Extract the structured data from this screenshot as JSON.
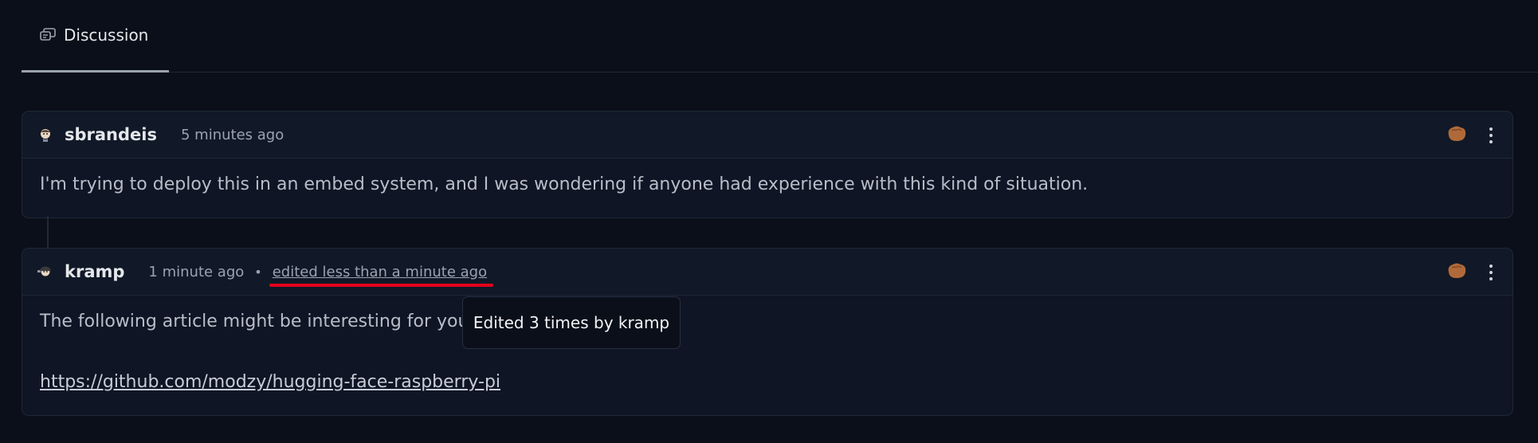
{
  "tabs": [
    {
      "label": "Discussion",
      "icon": "discussion-icon",
      "active": true
    }
  ],
  "comments": [
    {
      "username": "sbrandeis",
      "time": "5 minutes ago",
      "text": "I'm trying to deploy this in an embed system, and I was wondering if anyone had experience with this kind of situation."
    },
    {
      "username": "kramp",
      "time": "1 minute ago",
      "separator": "•",
      "edited": "edited less than a minute ago",
      "text": "The following article might be interesting for you:",
      "link": "https://github.com/modzy/hugging-face-raspberry-pi"
    }
  ],
  "tooltip": {
    "text": "Edited 3 times by kramp"
  },
  "colors": {
    "accent_underline": "#e3001b",
    "background": "#0b0f19",
    "card": "#0f1524"
  }
}
